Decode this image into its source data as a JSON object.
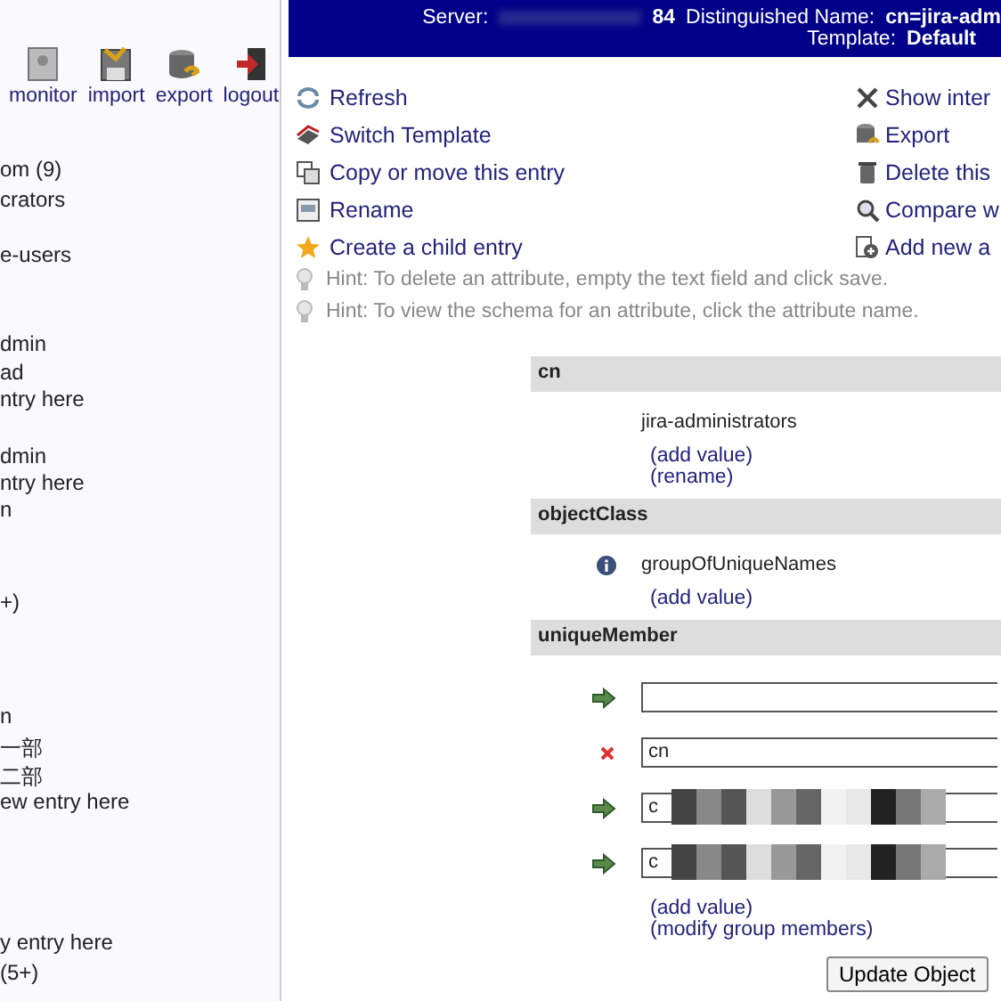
{
  "toolbar": [
    "monitor",
    "import",
    "export",
    "logout"
  ],
  "tree": [
    "om (9)",
    "crators",
    "e-users",
    "dmin",
    "ad",
    "ntry here",
    "dmin",
    "ntry here",
    "n",
    "+)",
    "n",
    "一部",
    "二部",
    "ew entry here",
    "y entry here",
    "(5+)"
  ],
  "header": {
    "server_label": "Server:",
    "server_value": "84",
    "dn_label": "Distinguished Name:",
    "dn_value": "cn=jira-adm",
    "template_label": "Template:",
    "template_value": "Default"
  },
  "actions_left": [
    "Refresh",
    "Switch Template",
    "Copy or move this entry",
    "Rename",
    "Create a child entry"
  ],
  "actions_right": [
    "Show inter",
    "Export",
    "Delete this",
    "Compare w",
    "Add new a"
  ],
  "hints": [
    "Hint: To delete an attribute, empty the text field and click save.",
    "Hint: To view the schema for an attribute, click the attribute name."
  ],
  "attributes": [
    {
      "name": "cn",
      "values": [
        {
          "text": "jira-administrators",
          "kind": "plain"
        }
      ],
      "links": [
        "(add value)",
        "(rename)"
      ]
    },
    {
      "name": "objectClass",
      "values": [
        {
          "text": "groupOfUniqueNames",
          "kind": "info"
        }
      ],
      "links": [
        "(add value)"
      ]
    },
    {
      "name": "uniqueMember",
      "members": [
        {
          "kind": "new"
        },
        {
          "kind": "delete",
          "value": "cn"
        },
        {
          "kind": "existing",
          "value": "c"
        },
        {
          "kind": "existing",
          "value": "c"
        }
      ],
      "links": [
        "(add value)",
        "(modify group members)"
      ]
    }
  ],
  "submit": "Update Object"
}
